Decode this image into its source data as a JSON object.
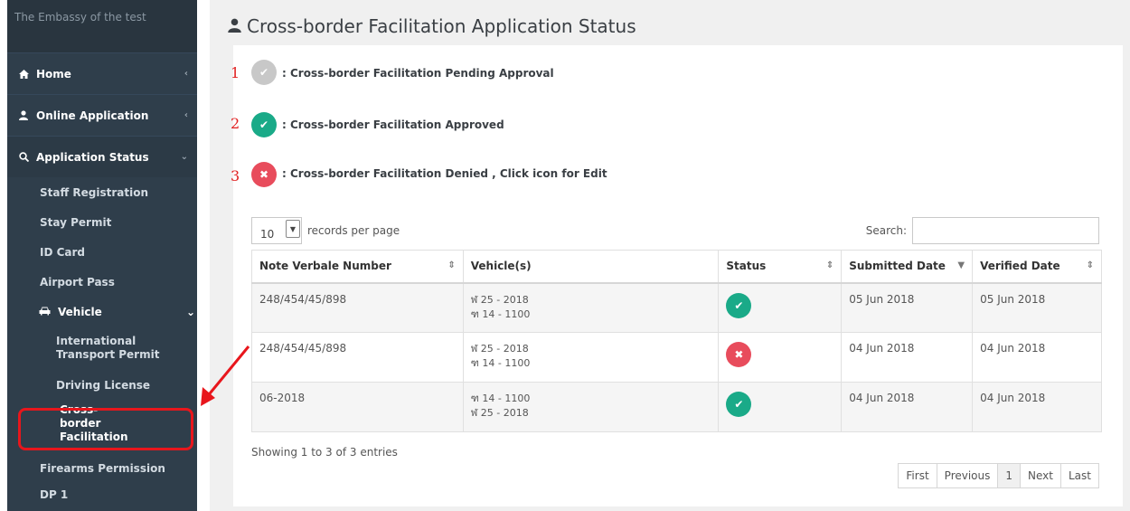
{
  "sidebar": {
    "brand": "The Embassy of the test",
    "items": [
      {
        "label": "Home",
        "icon": "home-icon"
      },
      {
        "label": "Online Application",
        "icon": "user-icon"
      },
      {
        "label": "Application Status",
        "icon": "search-icon"
      }
    ],
    "sub_items": [
      "Staff Registration",
      "Stay Permit",
      "ID Card",
      "Airport Pass"
    ],
    "vehicle": {
      "label": "Vehicle",
      "icon": "car-icon"
    },
    "vehicle_items": [
      "International Transport Permit",
      "Driving License",
      "Cross-border Facilitation"
    ],
    "after_items": [
      "Firearms Permission",
      "DP 1"
    ]
  },
  "main": {
    "title": "Cross-border Facilitation Application Status",
    "legend": [
      {
        "num": "1",
        "text": ": Cross-border Facilitation Pending Approval",
        "color": "#c8c8c8"
      },
      {
        "num": "2",
        "text": ": Cross-border Facilitation Approved",
        "color": "#1aaa88"
      },
      {
        "num": "3",
        "text": ": Cross-border Facilitation Denied , Click icon for Edit",
        "color": "#e84c5c"
      }
    ],
    "records_per_page": "10",
    "records_label": "records per page",
    "search_label": "Search:",
    "search_value": "",
    "table": {
      "headers": [
        "Note Verbale Number",
        "Vehicle(s)",
        "Status",
        "Submitted Date",
        "Verified Date"
      ],
      "rows": [
        {
          "note": "248/454/45/898",
          "vehicles": [
            "ฬ 25 - 2018",
            "ฑ 14 - 1100"
          ],
          "status": "approved",
          "submitted": "05 Jun 2018",
          "verified": "05 Jun 2018"
        },
        {
          "note": "248/454/45/898",
          "vehicles": [
            "ฬ 25 - 2018",
            "ฑ 14 - 1100"
          ],
          "status": "denied",
          "submitted": "04 Jun 2018",
          "verified": "04 Jun 2018"
        },
        {
          "note": "06-2018",
          "vehicles": [
            "ฑ 14 - 1100",
            "ฬ 25 - 2018"
          ],
          "status": "approved",
          "submitted": "04 Jun 2018",
          "verified": "04 Jun 2018"
        }
      ]
    },
    "info": "Showing 1 to 3 of 3 entries",
    "pager": [
      "First",
      "Previous",
      "1",
      "Next",
      "Last"
    ]
  },
  "colors": {
    "sidebar_bg": "#2f3e4b",
    "approved": "#1aaa88",
    "denied": "#e84c5c",
    "pending": "#c8c8c8",
    "highlight": "#e8161c"
  }
}
